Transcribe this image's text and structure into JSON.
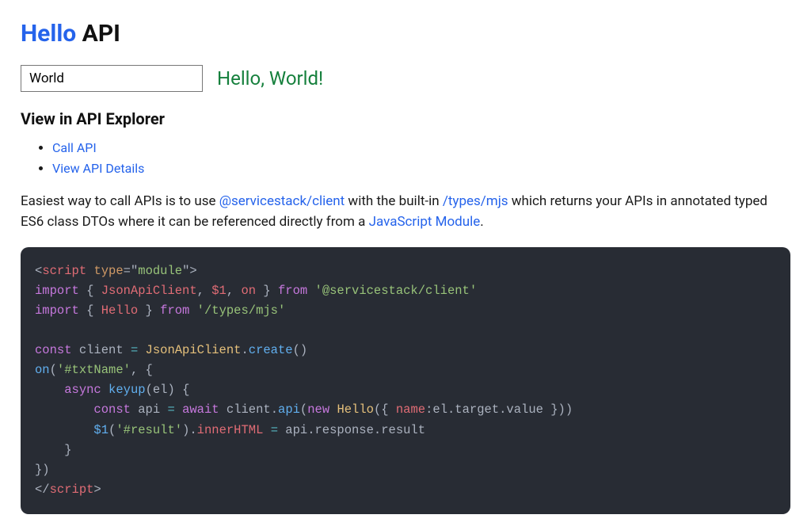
{
  "heading": {
    "first": "Hello",
    "second": " API"
  },
  "input": {
    "value": "World"
  },
  "result_text": "Hello, World!",
  "explorer": {
    "heading": "View in API Explorer",
    "links": [
      "Call API",
      "View API Details"
    ]
  },
  "paragraph": {
    "t0": "Easiest way to call APIs is to use ",
    "l0": "@servicestack/client",
    "t1": " with the built-in ",
    "l1": "/types/mjs",
    "t2": " which returns your APIs in annotated typed ES6 class DTOs where it can be referenced directly from a ",
    "l2": "JavaScript Module",
    "t3": "."
  },
  "code": {
    "line1": {
      "lt": "<",
      "tag": "script",
      "sp": " ",
      "attr": "type",
      "eq": "=",
      "q": "\"",
      "val": "module",
      "gt": ">"
    },
    "line2": {
      "imp": "import",
      "lb": " { ",
      "a": "JsonApiClient",
      "c1": ", ",
      "b": "$1",
      "c2": ", ",
      "c": "on",
      "rb": " } ",
      "from": "from",
      "sp": " ",
      "str": "'@servicestack/client'"
    },
    "line3": {
      "imp": "import",
      "lb": " { ",
      "a": "Hello",
      "rb": " } ",
      "from": "from",
      "sp": " ",
      "str": "'/types/mjs'"
    },
    "line5": {
      "cst": "const",
      "sp": " ",
      "v": "client",
      "eq": " = ",
      "cls": "JsonApiClient",
      "dot": ".",
      "fn": "create",
      "par": "()"
    },
    "line6": {
      "fn": "on",
      "op": "(",
      "str": "'#txtName'",
      "rest": ", {"
    },
    "line7": {
      "ind": "    ",
      "asy": "async",
      "sp": " ",
      "fn": "keyup",
      "op": "(",
      "arg": "el",
      "cp": ") {"
    },
    "line8": {
      "ind": "        ",
      "cst": "const",
      "sp": " ",
      "v": "api",
      "eq": " = ",
      "aw": "await",
      "sp2": " ",
      "cl": "client",
      "dot": ".",
      "fn": "api",
      "op": "(",
      "nw": "new",
      "sp3": " ",
      "cls": "Hello",
      "op2": "({ ",
      "prop": "name",
      "col": ":",
      "expr": "el.target.value",
      "cl2": " }))"
    },
    "line9": {
      "ind": "        ",
      "fn": "$1",
      "op": "(",
      "str": "'#result'",
      "cp": ").",
      "prop": "innerHTML",
      "eq": " = ",
      "expr": "api.response.result"
    },
    "line10": {
      "ind": "    ",
      "brace": "}"
    },
    "line11": {
      "brace": "})"
    },
    "line12": {
      "lt": "</",
      "tag": "script",
      "gt": ">"
    }
  }
}
